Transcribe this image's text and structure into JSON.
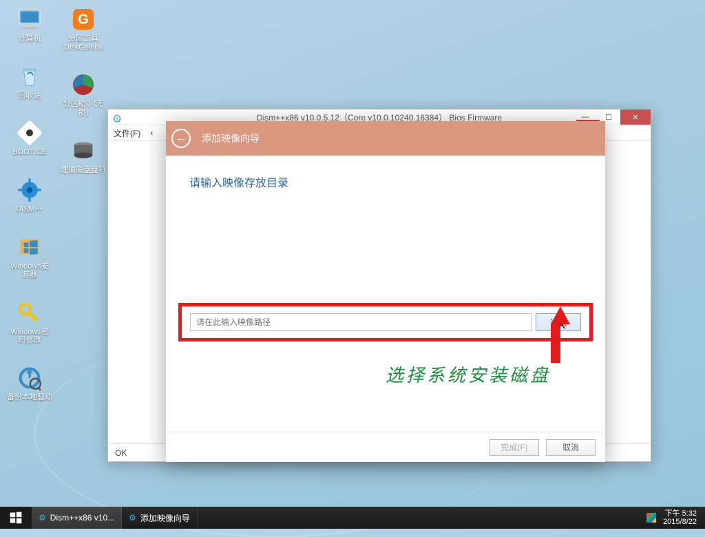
{
  "desktop_icons": {
    "computer": "计算机",
    "diskgenius": "分区工具\nDiskGenius",
    "recycle": "回收站",
    "partition_helper": "分区助手(无\n损)",
    "bootice": "BOOTICE",
    "disk_letter": "理顺磁盘盘符",
    "dismpp": "DISM++",
    "win_installer": "Windows安\n装器",
    "win_pwd": "Windows密\n码修改",
    "backup_drv": "备份本地驱动"
  },
  "parent_window": {
    "title": "Dism++x86 v10.0.5.12（Core v10.0.10240.16384） Bios Firmware",
    "menu_file": "文件(F)",
    "menu_more": "‹",
    "footer": "OK"
  },
  "wizard": {
    "title": "添加映像向导",
    "prompt": "请输入映像存放目录",
    "placeholder": "请在此输入映像路径",
    "browse": "浏览",
    "finish": "完成(F)",
    "cancel": "取消"
  },
  "annotation": "选择系统安装磁盘",
  "taskbar": {
    "item1": "Dism++x86 v10...",
    "item2": "添加映像向导",
    "time": "下午 5:32",
    "date": "2015/8/22"
  }
}
